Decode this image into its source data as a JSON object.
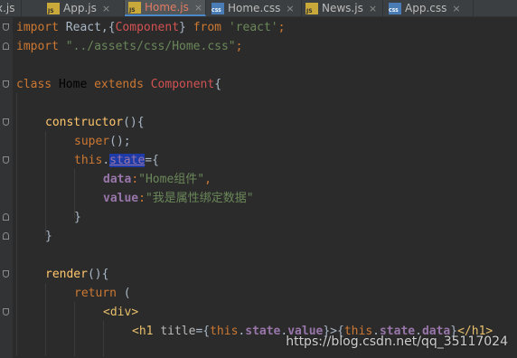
{
  "tabs": [
    {
      "label": "x.js",
      "type": "js",
      "active": false
    },
    {
      "label": "App.js",
      "type": "js",
      "active": false
    },
    {
      "label": "Home.js",
      "type": "js",
      "active": true
    },
    {
      "label": "Home.css",
      "type": "css",
      "active": false
    },
    {
      "label": "News.js",
      "type": "js",
      "active": false
    },
    {
      "label": "App.css",
      "type": "css",
      "active": false
    }
  ],
  "tab_close_glyph": "×",
  "code": {
    "l1": {
      "kw": "import",
      "a": " React,{",
      "comp": "Component",
      "b": "} ",
      "kw2": "from",
      "sp": " ",
      "str": "'react'",
      "end": ";"
    },
    "l2": {
      "kw": "import",
      "sp": " ",
      "str": "\"../assets/css/Home.css\"",
      "end": ";"
    },
    "l4": {
      "kw": "class",
      "sp": " ",
      "name": "Home",
      "sp2": " ",
      "kw2": "extends",
      "sp3": " ",
      "comp": "Component",
      "end": "{"
    },
    "l6": {
      "fn": "constructor",
      "end": "(){"
    },
    "l7": {
      "kw": "super",
      "end": "();"
    },
    "l8": {
      "kw": "this",
      "dot": ".",
      "member": "state",
      "end": "={"
    },
    "l9": {
      "key": "data",
      "colon": ":",
      "str": "\"Home组件\"",
      "end": ","
    },
    "l10": {
      "key": "value",
      "colon": ":",
      "str": "\"我是属性绑定数据\""
    },
    "l11": {
      "end": "}"
    },
    "l12": {
      "end": "}"
    },
    "l14": {
      "fn": "render",
      "end": "(){"
    },
    "l15": {
      "kw": "return",
      "end": " ("
    },
    "l16": {
      "open": "<",
      "tag": "div",
      "close": ">"
    },
    "l17": {
      "open": "<",
      "tag": "h1",
      "sp": " ",
      "attr": "title",
      "eq": "={",
      "this1": "this",
      "dot1": ".",
      "state1": "state",
      "dot2": ".",
      "value": "value",
      "mid": "}>{",
      "this2": "this",
      "dot3": ".",
      "state2": "state",
      "dot4": ".",
      "data": "data",
      "endc": "}",
      "closeopen": "</",
      "ctag": "h1",
      "closeend": ">"
    }
  },
  "watermark": "https://blog.csdn.net/qq_35117024"
}
